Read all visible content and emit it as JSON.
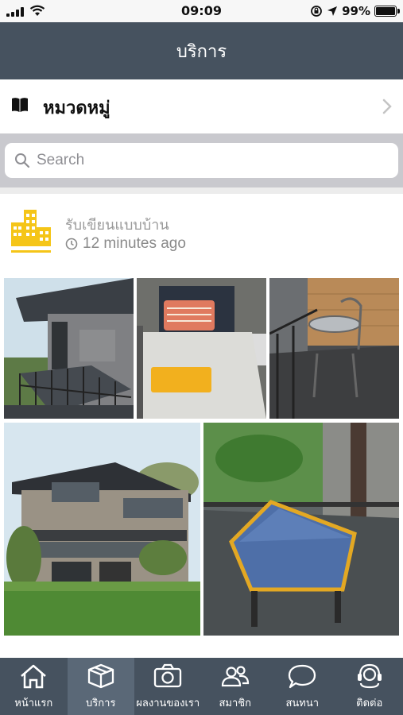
{
  "status_bar": {
    "time": "09:09",
    "battery": "99%"
  },
  "header": {
    "title": "บริการ"
  },
  "category": {
    "label": "หมวดหมู่",
    "icon": "book-icon"
  },
  "search": {
    "placeholder": "Search",
    "value": ""
  },
  "post": {
    "title": "รับเขียนแบบบ้าน",
    "time": "12 minutes ago",
    "logo_icon": "building-logo-icon",
    "photos": [
      "house-exterior-balcony-photo",
      "bedroom-bed-photo",
      "balcony-chairs-photo",
      "two-storey-house-photo",
      "blue-sofa-photo"
    ]
  },
  "tabs": [
    {
      "label": "หน้าแรก",
      "icon": "home-icon",
      "active": false
    },
    {
      "label": "บริการ",
      "icon": "box-icon",
      "active": true
    },
    {
      "label": "ผลงานของเรา",
      "icon": "camera-icon",
      "active": false
    },
    {
      "label": "สมาชิก",
      "icon": "members-icon",
      "active": false
    },
    {
      "label": "สนทนา",
      "icon": "chat-icon",
      "active": false
    },
    {
      "label": "ติดต่อ",
      "icon": "headset-icon",
      "active": false
    }
  ],
  "colors": {
    "header_bg": "#46525f",
    "active_tab_bg": "#5a6877",
    "logo_yellow": "#f5c518"
  }
}
